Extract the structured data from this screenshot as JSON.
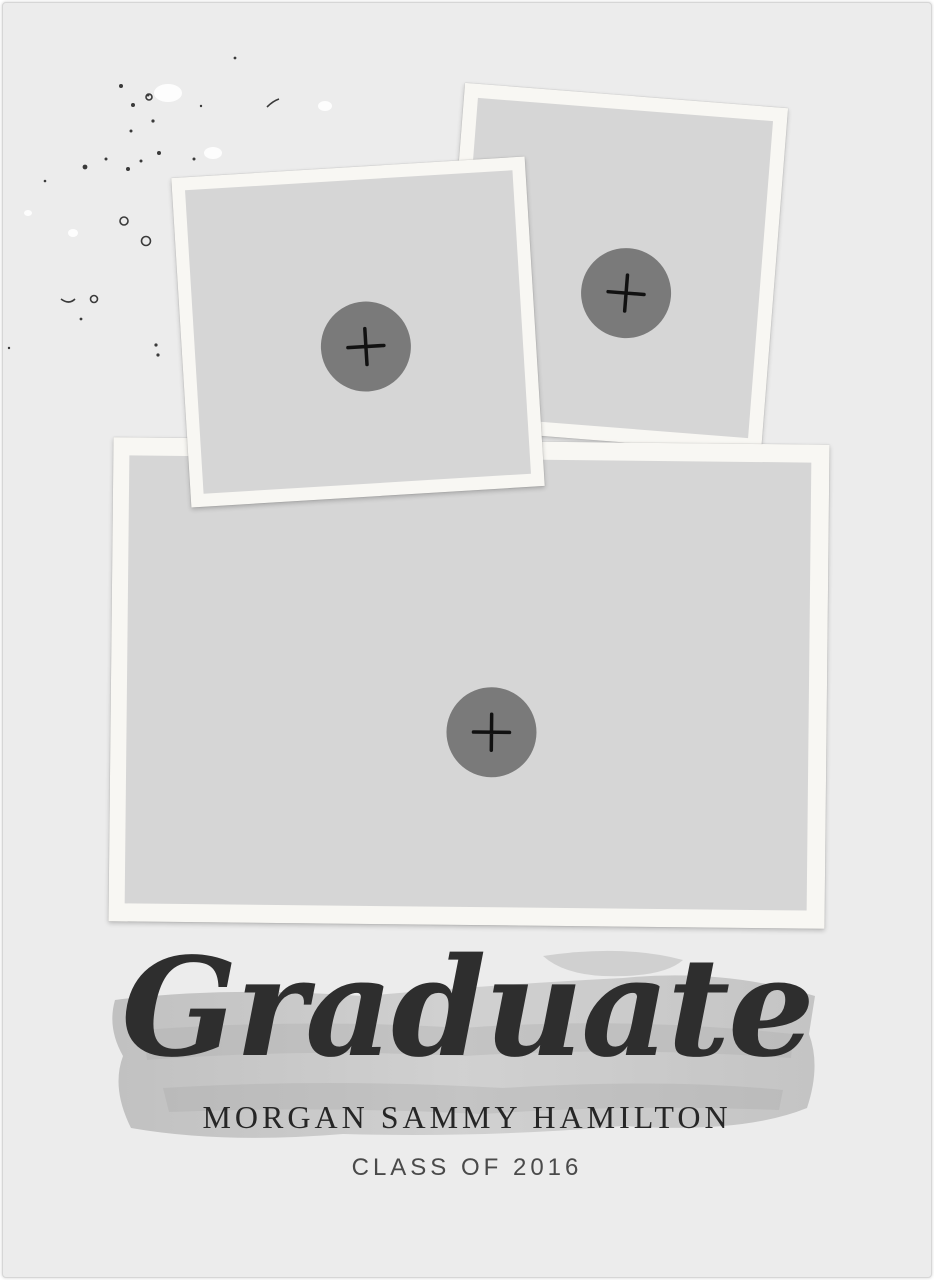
{
  "card": {
    "headline": "Graduate",
    "name": "MORGAN SAMMY HAMILTON",
    "class_year": "CLASS OF 2016"
  },
  "photo_slots": [
    {
      "icon": "plus-icon"
    },
    {
      "icon": "plus-icon"
    },
    {
      "icon": "plus-icon"
    }
  ],
  "colors": {
    "background": "#ececec",
    "frame": "#f8f7f3",
    "slot": "#d6d6d6",
    "add_button": "#7a7a7a",
    "text": "#2e2e2e"
  }
}
